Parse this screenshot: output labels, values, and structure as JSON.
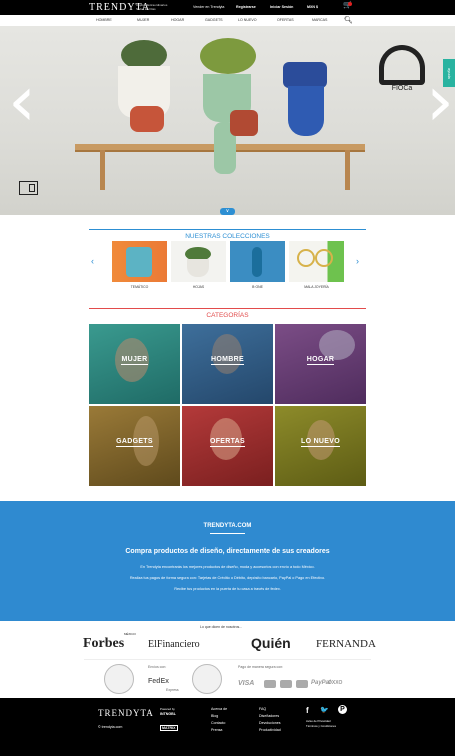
{
  "brand": {
    "logo": "TRENDYTA",
    "slogan": "Objetos Extraordinarios Todos los Días"
  },
  "topbar": {
    "links": [
      "Vender en Trendyta",
      "Registrarse",
      "Iniciar Sesión",
      "MXN $"
    ]
  },
  "nav": {
    "items": [
      "HOMBRE",
      "MUJER",
      "HOGAR",
      "GADGETS",
      "LO NUEVO",
      "OFERTAS",
      "MARCAS"
    ]
  },
  "hero": {
    "brand_name": "FIOCa"
  },
  "side_tab": {
    "label": "ayuda"
  },
  "collections": {
    "title": "NUESTRAS COLECCIONES",
    "items": [
      {
        "caption": "TEMÁTICO"
      },
      {
        "caption": "HOJAS"
      },
      {
        "caption": "B·ONE"
      },
      {
        "caption": "MALA JOYERÍA"
      }
    ]
  },
  "categories": {
    "title": "CATEGORÍAS",
    "items": [
      {
        "label": "MUJER",
        "color": "#2a8a85"
      },
      {
        "label": "HOMBRE",
        "color": "#2f5f8a"
      },
      {
        "label": "HOGAR",
        "color": "#6d3f7a"
      },
      {
        "label": "GADGETS",
        "color": "#8a6a2a"
      },
      {
        "label": "OFERTAS",
        "color": "#9b2b2b"
      },
      {
        "label": "LO NUEVO",
        "color": "#7c7a1e"
      }
    ]
  },
  "about": {
    "title": "TRENDYTA.COM",
    "subtitle": "Compra productos de diseño, directamente de sus creadores",
    "paragraphs": [
      "En Trendyta encontrarás los mejores productos de diseño, moda y accesorios con envío a todo México.",
      "Realiza tus pagos de forma segura con: Tarjetas de Crédito o Débito, depósito bancario, PayPal o Pago en Efectivo.",
      "Recibe tus productos en la puerta de tu casa a través de fedex."
    ]
  },
  "press": {
    "label": "Lo que dicen de nosotros...",
    "logos": [
      "Forbes",
      "ElFinanciero",
      "Quién",
      "FERNANDA"
    ],
    "forbes_tag": "MÉXICO"
  },
  "trust": {
    "shipping_label": "Envíos con:",
    "shipping_brand": "FedEx",
    "shipping_sub": "Express",
    "payment_label": "Pago de manera segura con:",
    "payment_brands": [
      "VISA",
      "PayPal",
      "OXXO"
    ]
  },
  "footer": {
    "logo": "TRENDYTA",
    "copyright": "© trendyta.com",
    "powered_label": "Powered by",
    "powered_brand": "INTNGBL",
    "partner_brand": "MATRIX",
    "links_col1": [
      "Acerca de",
      "Blog",
      "Contacto",
      "Prensa"
    ],
    "links_col2": [
      "FAQ",
      "Diseñadores",
      "Devoluciones",
      "Productividad"
    ],
    "social": [
      "f",
      "🐦",
      "P"
    ],
    "legal": [
      "Aviso de Privacidad",
      "Términos y Condiciones"
    ]
  },
  "colors": {
    "accent_blue": "#2d8fd3",
    "accent_red": "#e24b4b",
    "band_blue": "#2f8ad0",
    "teal": "#29b3a0"
  }
}
